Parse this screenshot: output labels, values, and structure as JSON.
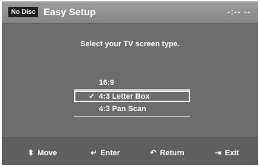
{
  "header": {
    "disc_status": "No Disc",
    "title": "Easy Setup",
    "clock": "-:-- --"
  },
  "main": {
    "prompt": "Select your TV screen type.",
    "options": [
      {
        "label": "16:9",
        "selected": false
      },
      {
        "label": "4:3 Letter Box",
        "selected": true,
        "check_mark": "✓"
      },
      {
        "label": "4:3 Pan Scan",
        "selected": false
      }
    ]
  },
  "footer": {
    "hints": [
      {
        "icon": "updown-arrows-icon",
        "glyph": "⬍",
        "label": "Move"
      },
      {
        "icon": "enter-icon",
        "glyph": "↵",
        "label": "Enter"
      },
      {
        "icon": "return-icon",
        "glyph": "↶",
        "label": "Return"
      },
      {
        "icon": "exit-icon",
        "glyph": "⇥",
        "label": "Exit"
      }
    ]
  },
  "colors": {
    "background": "#6d6d6d",
    "header": "#909090",
    "footer": "#5f5f5f",
    "text": "#ffffff",
    "badge": "#222222"
  }
}
